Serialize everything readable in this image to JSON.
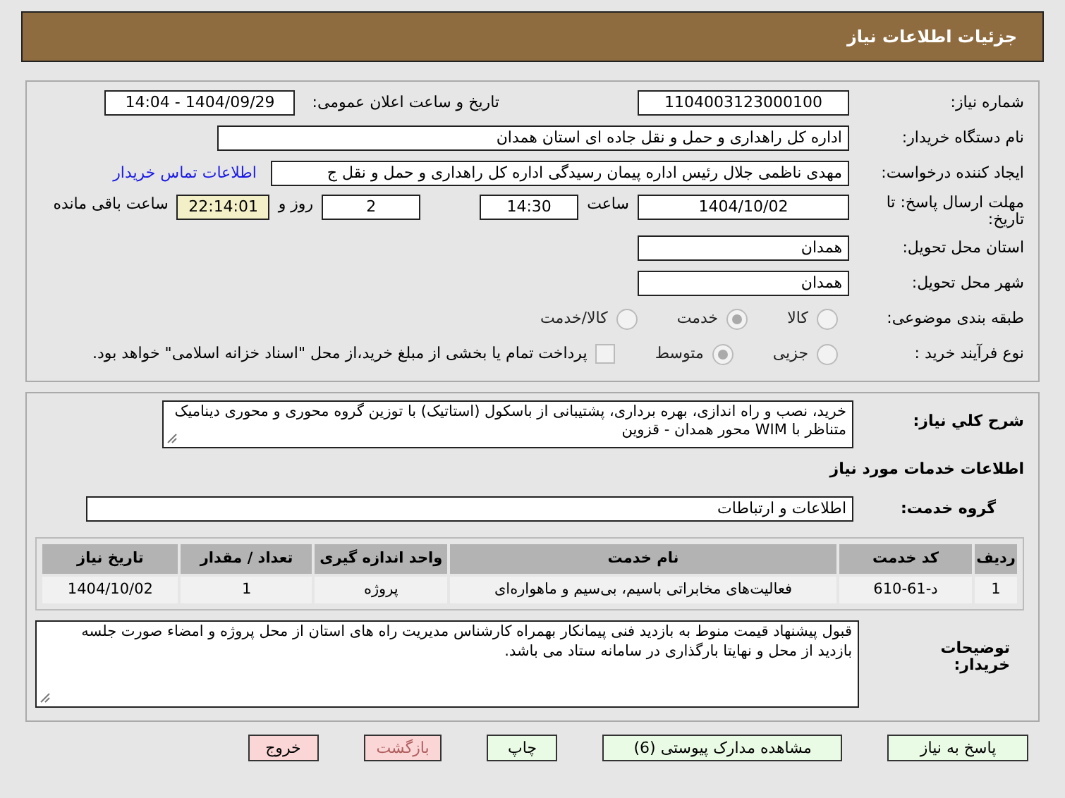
{
  "header": {
    "title": "جزئیات اطلاعات نیاز"
  },
  "need_number": {
    "label": "شماره نیاز:",
    "value": "1104003123000100"
  },
  "announce_date": {
    "label": "تاریخ و ساعت اعلان عمومی:",
    "value": "1404/09/29 - 14:04"
  },
  "buyer_org": {
    "label": "نام دستگاه خریدار:",
    "value": "اداره کل راهداری و حمل و نقل جاده ای استان همدان"
  },
  "requester": {
    "label": "ایجاد کننده درخواست:",
    "value": "مهدی ناظمی جلال رئیس اداره پیمان رسیدگی اداره کل راهداری و حمل و نقل ج",
    "contact_link": "اطلاعات تماس خریدار"
  },
  "deadline": {
    "label": "مهلت ارسال پاسخ: تا تاریخ:",
    "date": "1404/10/02",
    "time_label": "ساعت",
    "time": "14:30",
    "days": "2",
    "days_label": "روز و",
    "remaining": "22:14:01",
    "remaining_label": "ساعت باقی مانده"
  },
  "province": {
    "label": "استان محل تحویل:",
    "value": "همدان"
  },
  "city": {
    "label": "شهر محل تحویل:",
    "value": "همدان"
  },
  "category": {
    "label": "طبقه بندی موضوعی:",
    "options": [
      {
        "label": "کالا",
        "selected": false
      },
      {
        "label": "خدمت",
        "selected": true
      },
      {
        "label": "کالا/خدمت",
        "selected": false
      }
    ]
  },
  "purchase_type": {
    "label": "نوع فرآیند خرید :",
    "options": [
      {
        "label": "جزیی",
        "selected": false
      },
      {
        "label": "متوسط",
        "selected": true
      }
    ],
    "payment_checkbox": {
      "label": "پرداخت تمام یا بخشی از مبلغ خرید،از محل \"اسناد خزانه اسلامی\" خواهد بود.",
      "checked": false
    }
  },
  "description": {
    "label": "شرح کلي نياز:",
    "value": "خرید، نصب و راه اندازی، بهره برداری، پشتیبانی از باسکول (استاتیک) با توزین گروه محوری و محوری دینامیک متناظر با  WIM محور همدان - قزوین"
  },
  "services_title": "اطلاعات خدمات مورد نیاز",
  "service_group": {
    "label": "گروه خدمت:",
    "value": "اطلاعات و ارتباطات"
  },
  "table": {
    "columns": [
      "ردیف",
      "کد خدمت",
      "نام خدمت",
      "واحد اندازه گیری",
      "تعداد / مقدار",
      "تاریخ نیاز"
    ],
    "rows": [
      [
        "1",
        "د-61-610",
        "فعالیت‌های مخابراتی باسیم، بی‌سیم و ماهواره‌ای",
        "پروژه",
        "1",
        "1404/10/02"
      ]
    ]
  },
  "buyer_notes": {
    "label": "توضیحات خریدار:",
    "value": "قبول پیشنهاد قیمت منوط به بازدید فنی پیمانکار بهمراه کارشناس مدیریت راه های استان از محل پروژه و امضاء صورت جلسه بازدید از محل و نهایتا بارگذاری در سامانه ستاد می باشد."
  },
  "buttons": [
    {
      "label": "پاسخ به نیاز",
      "kind": "go"
    },
    {
      "label": "مشاهده مدارک پیوستی (6)",
      "kind": "go"
    },
    {
      "label": "چاپ",
      "kind": "go"
    },
    {
      "label": "بازگشت",
      "kind": "stop"
    },
    {
      "label": "خروج",
      "kind": "stop"
    }
  ]
}
